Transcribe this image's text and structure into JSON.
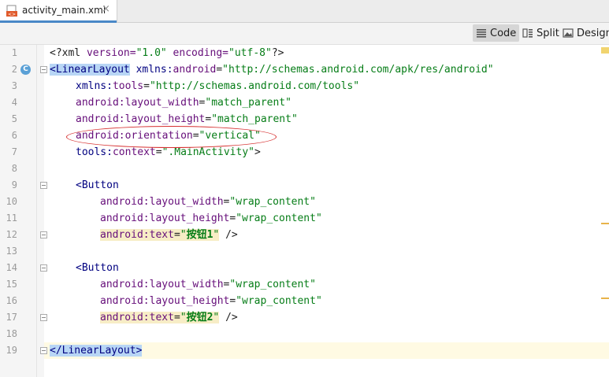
{
  "tab": {
    "filename": "activity_main.xml",
    "close": "×"
  },
  "view_modes": [
    {
      "label": "Code",
      "active": true,
      "icon": "lines-icon"
    },
    {
      "label": "Split",
      "active": false,
      "icon": "split-icon"
    },
    {
      "label": "Design",
      "active": false,
      "icon": "image-icon"
    }
  ],
  "colors": {
    "tag": "#000080",
    "attribute": "#660e7a",
    "value": "#067d17",
    "selection": "#b8d6f5",
    "annotation": "#d62f2f"
  },
  "code": {
    "l1": {
      "a": "<?xml ",
      "b": "version=",
      "c": "\"1.0\"",
      "d": " encoding=",
      "e": "\"utf-8\"",
      "f": "?>"
    },
    "l2": {
      "tag": "<LinearLayout",
      "ns": " xmlns:",
      "attr": "android",
      "eq": "=",
      "val": "\"http://schemas.android.com/apk/res/android\""
    },
    "l3": {
      "ns": "xmlns:",
      "attr": "tools",
      "eq": "=",
      "val": "\"http://schemas.android.com/tools\""
    },
    "l4": {
      "ns": "android:",
      "attr": "layout_width",
      "eq": "=",
      "val": "\"match_parent\""
    },
    "l5": {
      "ns": "android:",
      "attr": "layout_height",
      "eq": "=",
      "val": "\"match_parent\""
    },
    "l6": {
      "ns": "android:",
      "attr": "orientation",
      "eq": "=",
      "val": "\"vertical\""
    },
    "l7": {
      "ns": "tools:",
      "attr": "context",
      "eq": "=",
      "val": "\".MainActivity\"",
      "end": ">"
    },
    "l9": {
      "tag": "<Button"
    },
    "l10": {
      "ns": "android:",
      "attr": "layout_width",
      "eq": "=",
      "val": "\"wrap_content\""
    },
    "l11": {
      "ns": "android:",
      "attr": "layout_height",
      "eq": "=",
      "val": "\"wrap_content\""
    },
    "l12": {
      "ns": "android:",
      "attr": "text",
      "eq": "=",
      "q1": "\"",
      "txt": "按钮1",
      "q2": "\"",
      "end": " />"
    },
    "l14": {
      "tag": "<Button"
    },
    "l15": {
      "ns": "android:",
      "attr": "layout_width",
      "eq": "=",
      "val": "\"wrap_content\""
    },
    "l16": {
      "ns": "android:",
      "attr": "layout_height",
      "eq": "=",
      "val": "\"wrap_content\""
    },
    "l17": {
      "ns": "android:",
      "attr": "text",
      "eq": "=",
      "q1": "\"",
      "txt": "按钮2",
      "q2": "\"",
      "end": " />"
    },
    "l19": {
      "tag": "</LinearLayout>"
    }
  },
  "line_numbers": [
    "1",
    "2",
    "3",
    "4",
    "5",
    "6",
    "7",
    "8",
    "9",
    "10",
    "11",
    "12",
    "13",
    "14",
    "15",
    "16",
    "17",
    "18",
    "19"
  ],
  "gutter_badge": "C"
}
